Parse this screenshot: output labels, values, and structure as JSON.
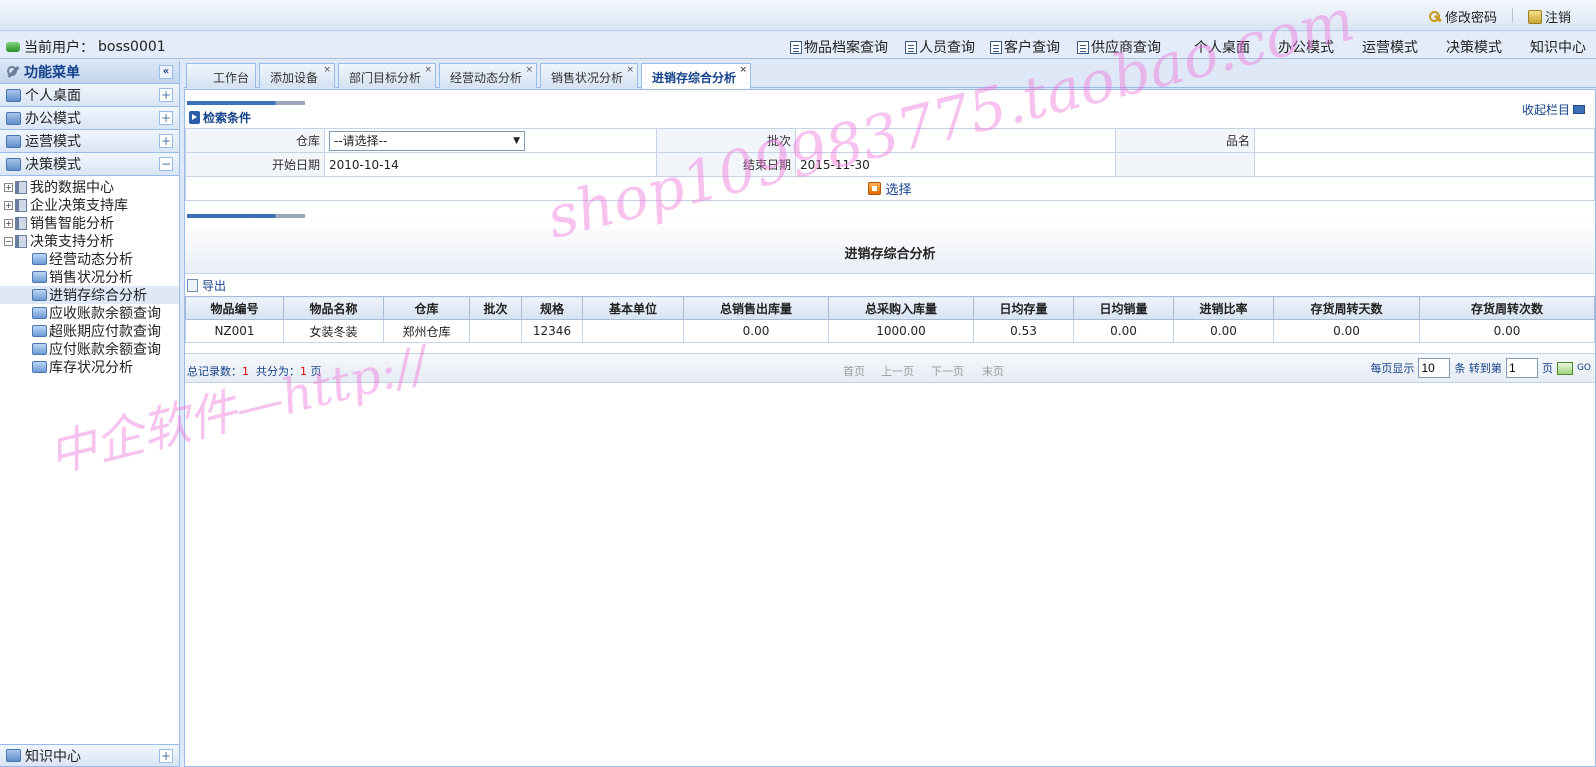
{
  "topbar": {
    "change_password": "修改密码",
    "logout": "注销"
  },
  "navbar": {
    "current_user_label": "当前用户：",
    "current_user": "boss0001",
    "items": [
      {
        "label": "物品档案查询",
        "icon": "document-icon"
      },
      {
        "label": "人员查询",
        "icon": "document-icon"
      },
      {
        "label": "客户查询",
        "icon": "document-icon"
      },
      {
        "label": "供应商查询",
        "icon": "document-icon"
      },
      {
        "label": "个人桌面"
      },
      {
        "label": "办公模式"
      },
      {
        "label": "运营模式"
      },
      {
        "label": "决策模式"
      },
      {
        "label": "知识中心"
      }
    ]
  },
  "sidebar": {
    "title": "功能菜单",
    "collapse": "«",
    "sections": [
      {
        "label": "个人桌面",
        "toggle": "+"
      },
      {
        "label": "办公模式",
        "toggle": "+"
      },
      {
        "label": "运营模式",
        "toggle": "+"
      },
      {
        "label": "决策模式",
        "toggle": "−"
      }
    ],
    "tree": {
      "folders": [
        {
          "label": "我的数据中心",
          "exp": "+"
        },
        {
          "label": "企业决策支持库",
          "exp": "+"
        },
        {
          "label": "销售智能分析",
          "exp": "+"
        },
        {
          "label": "决策支持分析",
          "exp": "−"
        }
      ],
      "leaves": [
        "经营动态分析",
        "销售状况分析",
        "进销存综合分析",
        "应收账款余额查询",
        "超账期应付款查询",
        "应付账款余额查询",
        "库存状况分析"
      ],
      "active_leaf": "进销存综合分析"
    },
    "bottom": {
      "label": "知识中心",
      "toggle": "+"
    }
  },
  "tabs": [
    {
      "label": "工作台"
    },
    {
      "label": "添加设备",
      "close": "×"
    },
    {
      "label": "部门目标分析",
      "close": "×"
    },
    {
      "label": "经营动态分析",
      "close": "×"
    },
    {
      "label": "销售状况分析",
      "close": "×"
    },
    {
      "label": "进销存综合分析",
      "close": "×",
      "active": true
    }
  ],
  "search": {
    "title": "检索条件",
    "collapse_label": "收起栏目",
    "warehouse_label": "仓库",
    "warehouse_value": "--请选择--",
    "batch_label": "批次",
    "batch_value": "",
    "name_label": "品名",
    "name_value": "",
    "start_date_label": "开始日期",
    "start_date": "2010-10-14",
    "end_date_label": "结束日期",
    "end_date": "2015-11-30",
    "choose_button": "选择"
  },
  "report": {
    "title": "进销存综合分析",
    "export_label": "导出",
    "columns": [
      "物品编号",
      "物品名称",
      "仓库",
      "批次",
      "规格",
      "基本单位",
      "总销售出库量",
      "总采购入库量",
      "日均存量",
      "日均销量",
      "进销比率",
      "存货周转天数",
      "存货周转次数"
    ],
    "rows": [
      [
        "NZ001",
        "女装冬装",
        "郑州仓库",
        "",
        "12346",
        "",
        "0.00",
        "1000.00",
        "0.53",
        "0.00",
        "0.00",
        "0.00",
        "0.00"
      ]
    ]
  },
  "pager": {
    "total_label": "总记录数：",
    "total": "1",
    "pages_label": "共分为：",
    "pages": "1",
    "pages_unit": "页",
    "first": "首页",
    "prev": "上一页",
    "next": "下一页",
    "last": "末页",
    "per_page_label": "每页显示",
    "per_page": "10",
    "goto_label": "条 转到第",
    "goto_page": "1",
    "page_unit": "页",
    "go": "GO"
  },
  "watermark": {
    "url": "shop109983775.taobao.com",
    "brand": "中企软件—http://"
  },
  "colors": {
    "accent": "#15428b",
    "border": "#99bbe8",
    "watermark": "#f078dc"
  }
}
